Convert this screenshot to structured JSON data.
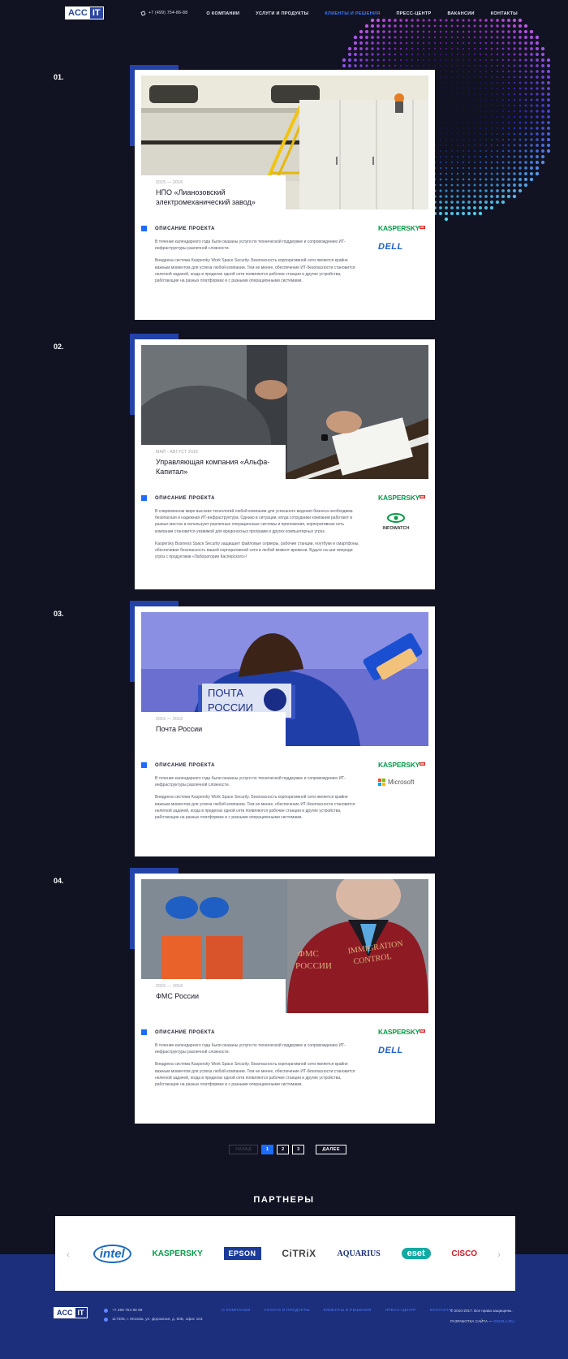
{
  "header": {
    "logo_left": "ACC",
    "logo_right": "IT",
    "phone": "+7 (499) 754-86-88",
    "nav": [
      {
        "label": "О КОМПАНИИ",
        "active": false
      },
      {
        "label": "УСЛУГИ И ПРОДУКТЫ",
        "active": false
      },
      {
        "label": "КЛИЕНТЫ И РЕШЕНИЯ",
        "active": true
      },
      {
        "label": "ПРЕСС-ЦЕНТР",
        "active": false
      },
      {
        "label": "ВАКАНСИИ",
        "active": false
      },
      {
        "label": "КОНТАКТЫ",
        "active": false
      }
    ]
  },
  "projects": [
    {
      "number": "01.",
      "years": "2015 — 2016",
      "title": "НПО «Лианозовский электромеханический завод»",
      "desc_heading": "ОПИСАНИЕ ПРОЕКТА",
      "paragraphs": [
        "В течение календарного года были оказаны услуги по технической поддержке и сопровождению ИТ-инфраструктуры различной сложности.",
        "Внедрена система Kaspersky Work Space Security. Безопасность корпоративной сети является крайне важным моментом для успеха любой компании. Тем не менее, обеспечение ИТ-безопасности становится нелегкой задачей, когда в пределах одной сети появляются рабочие станции и другие устройства, работающие на разных платформах и с разными операционными системами."
      ],
      "brands": [
        "KASPERSKY",
        "DELL"
      ]
    },
    {
      "number": "02.",
      "years": "МАЙ - АВГУСТ 2016",
      "title": "Управляющая компания «Альфа-Капитал»",
      "desc_heading": "ОПИСАНИЕ ПРОЕКТА",
      "paragraphs": [
        "В современном мире высоких технологий любой компании для успешного ведения бизнеса необходима безопасная и надежная ИТ-инфраструктура. Однако в ситуации, когда сотрудники компании работают в разных местах и используют различные операционные системы и приложения, корпоративная сеть компании становится уязвимой для вредоносных программ и других компьютерных угроз.",
        "Kaspersky Business Space Security защищает файловые серверы, рабочие станции, ноутбуки и смартфоны, обеспечивая безопасность вашей корпоративной сети в любой момент времени. Будьте на шаг впереди угроз с продуктами «Лаборатории Касперского»!"
      ],
      "brands": [
        "KASPERSKY",
        "INFOWATCH"
      ]
    },
    {
      "number": "03.",
      "years": "2015 — 2016",
      "title": "Почта России",
      "desc_heading": "ОПИСАНИЕ ПРОЕКТА",
      "paragraphs": [
        "В течение календарного года были оказаны услуги по технической поддержке и сопровождению ИТ-инфраструктуры различной сложности.",
        "Внедрена система Kaspersky Work Space Security. Безопасность корпоративной сети является крайне важным моментом для успеха любой компании. Тем не менее, обеспечение ИТ-безопасности становится нелегкой задачей, когда в пределах одной сети появляются рабочие станции и другие устройства, работающие на разных платформах и с разными операционными системами."
      ],
      "brands": [
        "KASPERSKY",
        "Microsoft"
      ]
    },
    {
      "number": "04.",
      "years": "2015 — 2016",
      "title": "ФМС России",
      "desc_heading": "ОПИСАНИЕ ПРОЕКТА",
      "paragraphs": [
        "В течение календарного года были оказаны услуги по технической поддержке и сопровождению ИТ-инфраструктуры различной сложности.",
        "Внедрена система Kaspersky Work Space Security. Безопасность корпоративной сети является крайне важным моментом для успеха любой компании. Тем не менее, обеспечение ИТ-безопасности становится нелегкой задачей, когда в пределах одной сети появляются рабочие станции и другие устройства, работающие на разных платформах и с разными операционными системами."
      ],
      "brands": [
        "KASPERSKY",
        "DELL"
      ]
    }
  ],
  "photo_texts": {
    "pochta_line1": "ПОЧТА",
    "pochta_line2": "РОССИИ",
    "fms_line1": "ФМС",
    "fms_line2": "РОССИИ",
    "immigration": "IMMIGRATION",
    "control": "CONTROL"
  },
  "pagination": {
    "prev": "НАЗАД",
    "pages": [
      "1",
      "2",
      "3"
    ],
    "current": "1",
    "next": "ДАЛЕЕ"
  },
  "partners": {
    "title": "ПАРТНЕРЫ",
    "prev_arrow": "‹",
    "next_arrow": "›",
    "logos": [
      "intel",
      "KASPERSKY",
      "EPSON",
      "CiTRiX",
      "AQUARIUS",
      "eset",
      "CISCO"
    ]
  },
  "footer": {
    "logo_left": "ACC",
    "logo_right": "IT",
    "phone": "+7 499 754 86 88",
    "address": "117405, г. Москва, ул. Дорожная, д. 60Б, офис 104",
    "nav": [
      "О КОМПАНИИ",
      "УСЛУГИ И ПРОДУКТЫ",
      "КЛИЕНТЫ И РЕШЕНИЯ",
      "ПРЕСС-ЦЕНТР",
      "КОНТАКТЫ"
    ],
    "copyright": "© 2010-2017. Все права защищены.",
    "dev_label": "РАЗРАБОТКА САЙТА —",
    "dev_name": "GIGOLA.RU"
  }
}
